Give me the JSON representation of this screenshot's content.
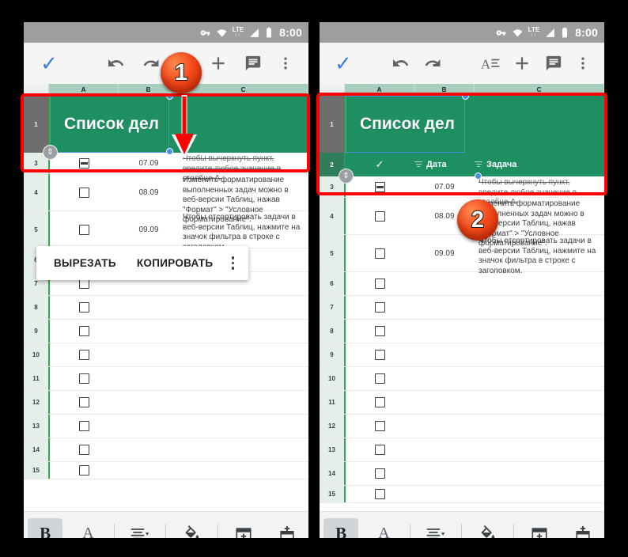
{
  "meta": {
    "accent_blue": "#3f7fe0",
    "sheet_green": "#1e8e63",
    "annotation_red": "#ff0000",
    "badge_orange": "#f4491a"
  },
  "status_bar": {
    "time": "8:00",
    "icons": [
      "vpn-key-icon",
      "wifi-icon",
      "lte-icon",
      "signal-icon",
      "battery-icon"
    ],
    "lte_label": "LTE",
    "lte_arrows": "↓↑"
  },
  "panels": [
    {
      "id": "left",
      "badge": "1",
      "toolbar": {
        "items": [
          {
            "name": "accept-button",
            "glyph": "✓"
          },
          {
            "name": "undo-button",
            "glyph": "↶"
          },
          {
            "name": "redo-button",
            "glyph": "↷"
          },
          {
            "name": "add-button",
            "glyph": "+"
          },
          {
            "name": "comment-button",
            "glyph": "▤"
          },
          {
            "name": "overflow-menu-button",
            "glyph": "⋮"
          }
        ]
      },
      "context_menu": {
        "cut_label": "ВЫРЕЗАТЬ",
        "copy_label": "КОПИРОВАТЬ",
        "more_label": "⋮"
      }
    },
    {
      "id": "right",
      "badge": "2",
      "toolbar": {
        "items": [
          {
            "name": "accept-button",
            "glyph": "✓"
          },
          {
            "name": "undo-button",
            "glyph": "↶"
          },
          {
            "name": "redo-button",
            "glyph": "↷"
          },
          {
            "name": "text-format-button",
            "glyph": "A≡"
          },
          {
            "name": "add-button",
            "glyph": "+"
          },
          {
            "name": "comment-button",
            "glyph": "▤"
          },
          {
            "name": "overflow-menu-button",
            "glyph": "⋮"
          }
        ]
      }
    }
  ],
  "spreadsheet": {
    "columns": [
      "A",
      "B",
      "C"
    ],
    "title_cell": "Список дел",
    "header_row": {
      "row_number": "2",
      "check_label": "✓",
      "date_label": "Дата",
      "task_label": "Задача"
    },
    "rows": [
      {
        "num": "3",
        "date": "07.09",
        "text": "Чтобы вычеркнуть пункт, введите любое значение в столбце A.",
        "checked": true
      },
      {
        "num": "4",
        "date": "08.09",
        "text": "Изменить форматирование выполненных задач можно в веб-версии Таблиц, нажав \"Формат\" > \"Условное форматирование\".",
        "checked": false
      },
      {
        "num": "5",
        "date": "09.09",
        "text": "Чтобы отсортировать задачи в веб-версии Таблиц, нажмите на значок фильтра в строке с заголовком.",
        "checked": false
      },
      {
        "num": "6",
        "date": "",
        "text": "",
        "checked": false
      },
      {
        "num": "7",
        "date": "",
        "text": "",
        "checked": false
      },
      {
        "num": "8",
        "date": "",
        "text": "",
        "checked": false
      },
      {
        "num": "9",
        "date": "",
        "text": "",
        "checked": false
      },
      {
        "num": "10",
        "date": "",
        "text": "",
        "checked": false
      },
      {
        "num": "11",
        "date": "",
        "text": "",
        "checked": false
      },
      {
        "num": "12",
        "date": "",
        "text": "",
        "checked": false
      },
      {
        "num": "13",
        "date": "",
        "text": "",
        "checked": false
      },
      {
        "num": "14",
        "date": "",
        "text": "",
        "checked": false
      },
      {
        "num": "15",
        "date": "",
        "text": "",
        "checked": false
      }
    ],
    "title_row_number": "1"
  },
  "format_toolbar": {
    "items": [
      {
        "name": "bold-button",
        "label": "B",
        "active": true
      },
      {
        "name": "text-color-button",
        "label": "A",
        "active": false
      },
      {
        "name": "align-button",
        "label": "≡",
        "active": false
      },
      {
        "name": "fill-color-button",
        "label": "fill",
        "active": false
      },
      {
        "name": "merge-cells-button",
        "label": "merge",
        "active": false
      },
      {
        "name": "insert-row-button",
        "label": "insert",
        "active": false
      }
    ]
  }
}
